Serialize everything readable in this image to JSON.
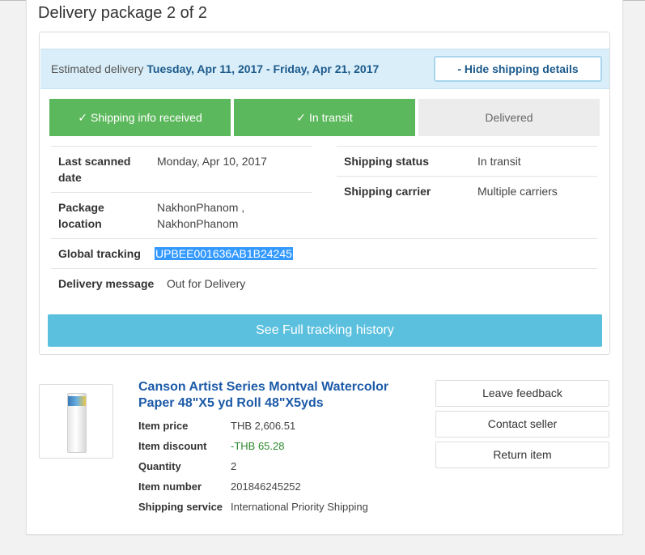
{
  "package": {
    "title": "Delivery package 2 of 2"
  },
  "estimate": {
    "label": "Estimated delivery",
    "dates": "Tuesday, Apr 11, 2017 - Friday, Apr 21, 2017",
    "toggle_label": "- Hide shipping details"
  },
  "steps": [
    {
      "check": "✓",
      "label": "Shipping info received",
      "state": "done"
    },
    {
      "check": "✓",
      "label": "In transit",
      "state": "done"
    },
    {
      "check": "",
      "label": "Delivered",
      "state": "pending"
    }
  ],
  "details": {
    "last_scanned_label": "Last scanned date",
    "last_scanned_value": "Monday, Apr 10, 2017",
    "location_label": "Package location",
    "location_value": "NakhonPhanom , NakhonPhanom",
    "status_label": "Shipping status",
    "status_value": "In transit",
    "carrier_label": "Shipping carrier",
    "carrier_value": "Multiple carriers",
    "tracking_label": "Global tracking",
    "tracking_value": "UPBEE001636AB1B24245",
    "message_label": "Delivery message",
    "message_value": "Out for Delivery"
  },
  "history_button": "See Full tracking history",
  "item": {
    "title": "Canson Artist Series Montval Watercolor Paper 48\"X5 yd Roll 48\"X5yds",
    "price_label": "Item price",
    "price_value": "THB 2,606.51",
    "discount_label": "Item discount",
    "discount_value": "-THB 65.28",
    "quantity_label": "Quantity",
    "quantity_value": "2",
    "number_label": "Item number",
    "number_value": "201846245252",
    "service_label": "Shipping service",
    "service_value": "International Priority Shipping"
  },
  "actions": {
    "feedback": "Leave feedback",
    "contact": "Contact seller",
    "return": "Return item"
  },
  "colors": {
    "done": "#5cb85c",
    "pending": "#ececec",
    "link": "#1c5aa8",
    "button": "#5bc0de",
    "estimate_bg": "#d9eef8"
  }
}
